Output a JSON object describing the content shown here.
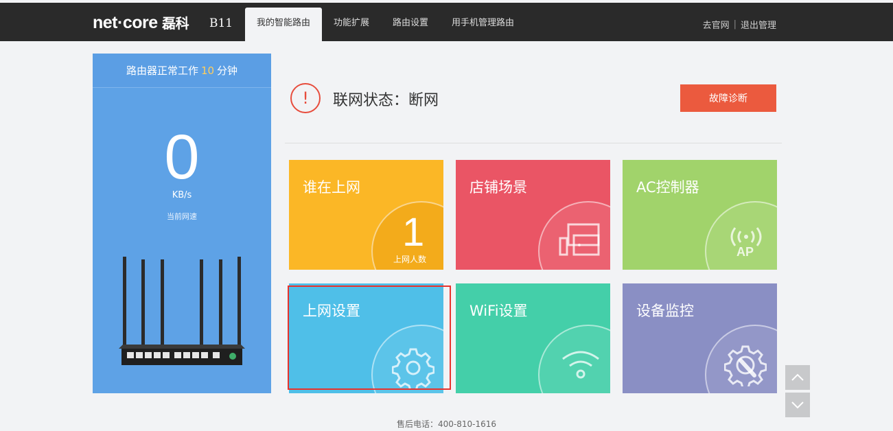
{
  "brand": {
    "logo_main": "net",
    "logo_dot": "·",
    "logo_rest": "core",
    "logo_cn": "磊科",
    "model": "B11"
  },
  "nav": [
    {
      "label": "我的智能路由"
    },
    {
      "label": "功能扩展"
    },
    {
      "label": "路由设置"
    },
    {
      "label": "用手机管理路由"
    }
  ],
  "top_links": {
    "website": "去官网",
    "separator": "|",
    "logout": "退出管理"
  },
  "uptime": {
    "prefix": "路由器正常工作",
    "value": "10",
    "unit": "分钟"
  },
  "speed": {
    "value": "0",
    "unit": "KB/s",
    "label": "当前网速"
  },
  "status": {
    "icon_text": "!",
    "text": "联网状态：断网",
    "diag_button": "故障诊断"
  },
  "tiles": [
    {
      "title": "谁在上网",
      "count": "1",
      "count_label": "上网人数",
      "color": "#fbb726"
    },
    {
      "title": "店铺场景",
      "icon": "store-display-icon",
      "color": "#ea5565"
    },
    {
      "title": "AC控制器",
      "icon": "ap-wireless-icon",
      "icon_text": "AP",
      "color": "#a1d36b"
    },
    {
      "title": "上网设置",
      "icon": "gear-icon",
      "color": "#4fbfe8"
    },
    {
      "title": "WiFi设置",
      "icon": "wifi-icon",
      "color": "#44cfa9"
    },
    {
      "title": "设备监控",
      "icon": "monitor-gear-icon",
      "color": "#8a8fc4"
    }
  ],
  "footer": {
    "hotline": "售后电话：400-810-1616"
  }
}
